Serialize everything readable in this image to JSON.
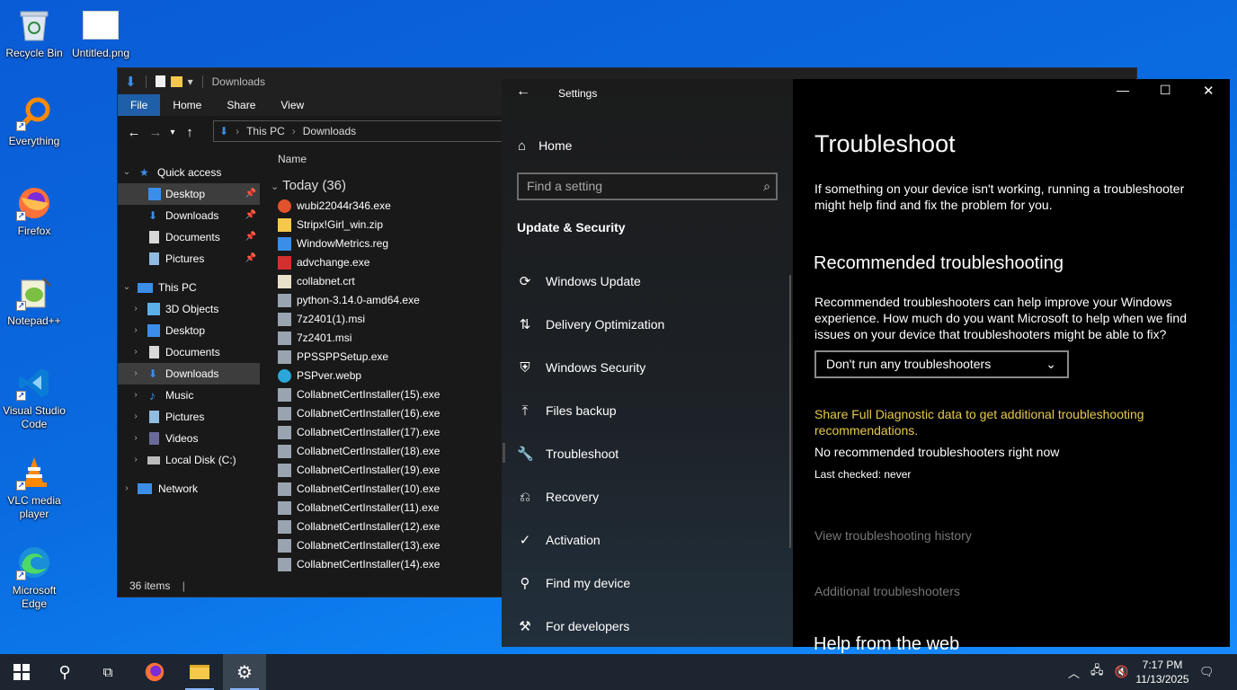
{
  "desktop": {
    "icons": [
      {
        "label": "Recycle Bin"
      },
      {
        "label": "Untitled.png"
      },
      {
        "label": "Everything"
      },
      {
        "label": "Firefox"
      },
      {
        "label": "Notepad++"
      },
      {
        "label": "Visual Studio Code"
      },
      {
        "label": "VLC media player"
      },
      {
        "label": "Microsoft Edge"
      }
    ]
  },
  "explorer": {
    "title": "Downloads",
    "ribbon_tabs": [
      "File",
      "Home",
      "Share",
      "View"
    ],
    "breadcrumb": [
      "This PC",
      "Downloads"
    ],
    "column_name": "Name",
    "group_label": "Today (36)",
    "tree": [
      {
        "label": "Quick access",
        "level": 0
      },
      {
        "label": "Desktop",
        "level": 1,
        "pinned": true,
        "selected": true
      },
      {
        "label": "Downloads",
        "level": 1,
        "pinned": true
      },
      {
        "label": "Documents",
        "level": 1,
        "pinned": true
      },
      {
        "label": "Pictures",
        "level": 1,
        "pinned": true
      },
      {
        "label": "This PC",
        "level": 0
      },
      {
        "label": "3D Objects",
        "level": 1
      },
      {
        "label": "Desktop",
        "level": 1
      },
      {
        "label": "Documents",
        "level": 1
      },
      {
        "label": "Downloads",
        "level": 1,
        "selected": true
      },
      {
        "label": "Music",
        "level": 1
      },
      {
        "label": "Pictures",
        "level": 1
      },
      {
        "label": "Videos",
        "level": 1
      },
      {
        "label": "Local Disk (C:)",
        "level": 1
      },
      {
        "label": "Network",
        "level": 0
      }
    ],
    "files": [
      {
        "name": "wubi22044r346.exe",
        "icon": "ubuntu-icon",
        "color": "#e2522c"
      },
      {
        "name": "Stripx!Girl_win.zip",
        "icon": "zip-icon",
        "color": "#f5c84b"
      },
      {
        "name": "WindowMetrics.reg",
        "icon": "registry-icon",
        "color": "#3b8ee8"
      },
      {
        "name": "advchange.exe",
        "icon": "app-icon",
        "color": "#d32f2f"
      },
      {
        "name": "collabnet.crt",
        "icon": "certificate-icon",
        "color": "#e8e0c8"
      },
      {
        "name": "python-3.14.0-amd64.exe",
        "icon": "installer-icon",
        "color": "#9aa4b0"
      },
      {
        "name": "7z2401(1).msi",
        "icon": "installer-icon",
        "color": "#9aa4b0"
      },
      {
        "name": "7z2401.msi",
        "icon": "installer-icon",
        "color": "#9aa4b0"
      },
      {
        "name": "PPSSPPSetup.exe",
        "icon": "installer-icon",
        "color": "#9aa4b0"
      },
      {
        "name": "PSPver.webp",
        "icon": "edge-icon",
        "color": "#2aa7d8"
      },
      {
        "name": "CollabnetCertInstaller(15).exe",
        "icon": "installer-icon",
        "color": "#9aa4b0"
      },
      {
        "name": "CollabnetCertInstaller(16).exe",
        "icon": "installer-icon",
        "color": "#9aa4b0"
      },
      {
        "name": "CollabnetCertInstaller(17).exe",
        "icon": "installer-icon",
        "color": "#9aa4b0"
      },
      {
        "name": "CollabnetCertInstaller(18).exe",
        "icon": "installer-icon",
        "color": "#9aa4b0"
      },
      {
        "name": "CollabnetCertInstaller(19).exe",
        "icon": "installer-icon",
        "color": "#9aa4b0"
      },
      {
        "name": "CollabnetCertInstaller(10).exe",
        "icon": "installer-icon",
        "color": "#9aa4b0"
      },
      {
        "name": "CollabnetCertInstaller(11).exe",
        "icon": "installer-icon",
        "color": "#9aa4b0"
      },
      {
        "name": "CollabnetCertInstaller(12).exe",
        "icon": "installer-icon",
        "color": "#9aa4b0"
      },
      {
        "name": "CollabnetCertInstaller(13).exe",
        "icon": "installer-icon",
        "color": "#9aa4b0"
      },
      {
        "name": "CollabnetCertInstaller(14).exe",
        "icon": "installer-icon",
        "color": "#9aa4b0"
      }
    ],
    "status": "36 items"
  },
  "settings": {
    "title": "Settings",
    "home_label": "Home",
    "search_placeholder": "Find a setting",
    "section": "Update & Security",
    "nav": [
      {
        "label": "Windows Update",
        "icon": "sync-icon"
      },
      {
        "label": "Delivery Optimization",
        "icon": "delivery-icon"
      },
      {
        "label": "Windows Security",
        "icon": "shield-icon"
      },
      {
        "label": "Files backup",
        "icon": "backup-icon"
      },
      {
        "label": "Troubleshoot",
        "icon": "wrench-icon",
        "selected": true
      },
      {
        "label": "Recovery",
        "icon": "recovery-icon"
      },
      {
        "label": "Activation",
        "icon": "check-circle-icon"
      },
      {
        "label": "Find my device",
        "icon": "person-pin-icon"
      },
      {
        "label": "For developers",
        "icon": "developer-icon"
      }
    ],
    "page": {
      "heading": "Troubleshoot",
      "intro": "If something on your device isn't working, running a troubleshooter might help find and fix the problem for you.",
      "rec_heading": "Recommended troubleshooting",
      "rec_text": "Recommended troubleshooters can help improve your Windows experience. How much do you want Microsoft to help when we find issues on your device that troubleshooters might be able to fix?",
      "dropdown_value": "Don't run any troubleshooters",
      "diag_link": "Share Full Diagnostic data to get additional troubleshooting recommendations.",
      "no_rec": "No recommended troubleshooters right now",
      "last_checked": "Last checked: never",
      "history_link": "View troubleshooting history",
      "additional_link": "Additional troubleshooters",
      "help_heading": "Help from the web"
    },
    "accent_link_color": "#e8c94b"
  },
  "taskbar": {
    "time": "7:17 PM",
    "date": "11/13/2025"
  }
}
